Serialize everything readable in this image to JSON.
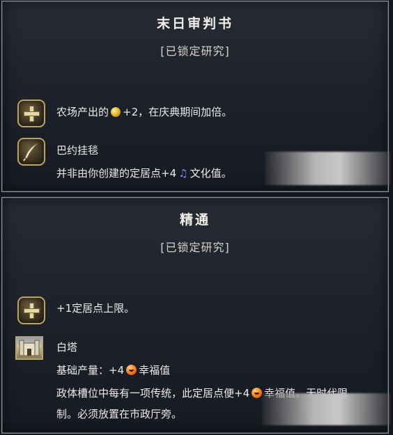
{
  "panels": [
    {
      "title": "末日审判书",
      "subtitle": "[已锁定研究]",
      "line1": {
        "text_a": "农场产出的",
        "text_b": "+2，在庆典期间加倍。"
      },
      "line2": {
        "name": "巴约挂毯"
      },
      "line3": {
        "text_a": "并非由你创建的定居点+4",
        "text_b": "文化值。"
      }
    },
    {
      "title": "精通",
      "subtitle": "[已锁定研究]",
      "line1": {
        "text": "+1定居点上限。"
      },
      "line2": {
        "name": "白塔"
      },
      "line3": {
        "text_a": "基础产量：+4",
        "text_b": "幸福值"
      },
      "line4": {
        "text_a": "政体槽位中每有一项传统，此定居点便+4",
        "text_b": "幸福值。无时代限"
      },
      "line5": {
        "text": "制。必须放置在市政厅旁。"
      }
    }
  ],
  "icons": {
    "plus": "plus-icon",
    "quill": "quill-icon",
    "gold": "gold-coin-icon",
    "culture": "music-note-icon",
    "amenity": "happy-face-icon",
    "tower": "white-tower-icon"
  },
  "colors": {
    "panel_border": "#8f939a",
    "icon_gold": "#b7a36c",
    "culture": "#7a8fff"
  }
}
